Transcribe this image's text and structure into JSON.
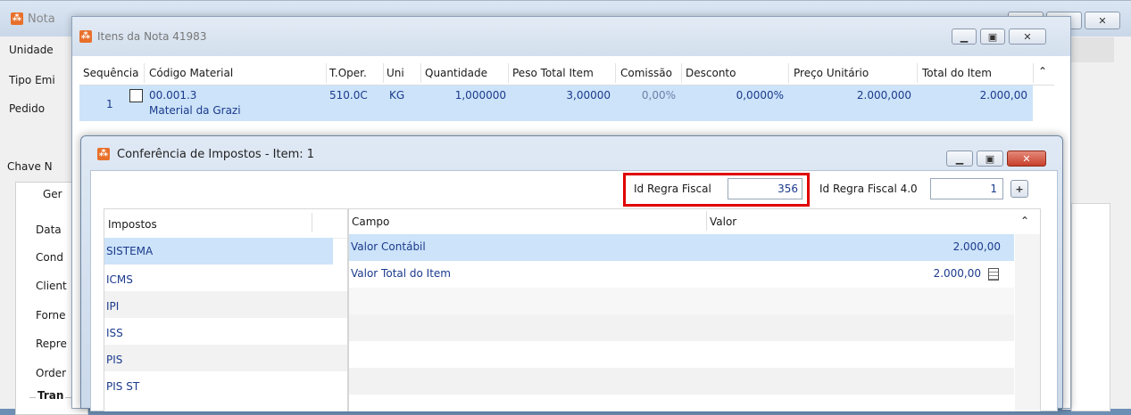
{
  "bg_window": {
    "title": "Nota",
    "labels": [
      "Unidade",
      "Tipo Emi",
      "Pedido",
      "Chave N",
      "Ger",
      "Data",
      "Cond",
      "Client",
      "Forne",
      "Repre",
      "Order",
      "Tran"
    ]
  },
  "items_window": {
    "title": "Itens da Nota 41983",
    "columns": [
      "Sequência",
      "Código Material",
      "T.Oper.",
      "Uni",
      "Quantidade",
      "Peso Total Item",
      "Comissão",
      "Desconto",
      "Preço Unitário",
      "Total do Item"
    ],
    "row": {
      "seq": "1",
      "codigo": "00.001.3",
      "descricao": "Material da Grazi",
      "toper": "510.0C",
      "uni": "KG",
      "quantidade": "1,000000",
      "peso": "3,00000",
      "comissao": "0,00%",
      "desconto": "0,0000%",
      "preco": "2.000,000",
      "total": "2.000,00"
    }
  },
  "conf_window": {
    "title": "Conferência de Impostos - Item: 1",
    "id_regra_label": "Id Regra Fiscal",
    "id_regra_value": "356",
    "id_regra40_label": "Id Regra Fiscal 4.0",
    "id_regra40_value": "1",
    "plus_label": "+",
    "impostos_header": "Impostos",
    "impostos": [
      "SISTEMA",
      "ICMS",
      "IPI",
      "ISS",
      "PIS",
      "PIS ST"
    ],
    "campo_header": "Campo",
    "valor_header": "Valor",
    "campos": [
      {
        "campo": "Valor Contábil",
        "valor": "2.000,00"
      },
      {
        "campo": "Valor Total do Item",
        "valor": "2.000,00"
      }
    ]
  },
  "colors": {
    "highlight_red": "#e00000",
    "selection": "#cce3f9",
    "title_text": "#333333"
  }
}
